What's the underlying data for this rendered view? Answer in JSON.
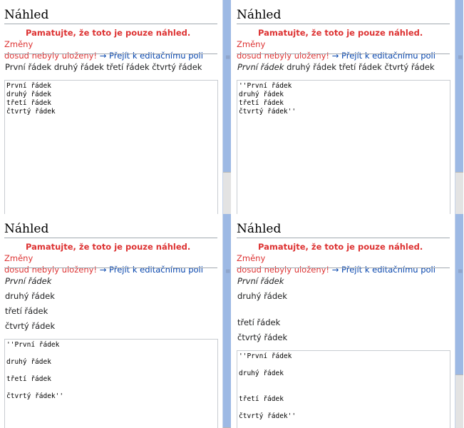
{
  "panels": [
    {
      "heading": "Náhled",
      "warning_bold": "Pamatujte, že toto je pouze náhled.",
      "warning_rest_1": " Změny",
      "warning_rest_2": "dosud nebyly uloženy!",
      "warning_link": "→ Přejít k editačnímu poli",
      "preview_lines": [
        {
          "italic": "",
          "normal": "První řádek druhý řádek třetí řádek čtvrtý řádek"
        }
      ],
      "textarea_lines": [
        "První řádek",
        "druhý řádek",
        "třetí řádek",
        "čtvrtý řádek"
      ]
    },
    {
      "heading": "Náhled",
      "warning_bold": "Pamatujte, že toto je pouze náhled.",
      "warning_rest_1": " Změny",
      "warning_rest_2": "dosud nebyly uloženy!",
      "warning_link": "→ Přejít k editačnímu poli",
      "preview_lines": [
        {
          "italic": "První řádek",
          "normal": " druhý řádek třetí řádek čtvrtý řádek"
        }
      ],
      "textarea_lines": [
        "''První řádek",
        "druhý řádek",
        "třetí řádek",
        "čtvrtý řádek''"
      ]
    },
    {
      "heading": "Náhled",
      "warning_bold": "Pamatujte, že toto je pouze náhled.",
      "warning_rest_1": " Změny",
      "warning_rest_2": "dosud nebyly uloženy!",
      "warning_link": "→ Přejít k editačnímu poli",
      "preview_lines": [
        {
          "italic": "První řádek",
          "normal": ""
        },
        {
          "italic": "",
          "normal": "druhý řádek"
        },
        {
          "italic": "",
          "normal": "třetí řádek"
        },
        {
          "italic": "",
          "normal": "čtvrtý řádek"
        }
      ],
      "textarea_lines": [
        "''První řádek",
        "",
        "druhý řádek",
        "",
        "třetí řádek",
        "",
        "čtvrtý řádek''"
      ]
    },
    {
      "heading": "Náhled",
      "warning_bold": "Pamatujte, že toto je pouze náhled.",
      "warning_rest_1": " Změny",
      "warning_rest_2": "dosud nebyly uloženy!",
      "warning_link": "→ Přejít k editačnímu poli",
      "preview_lines": [
        {
          "italic": "První řádek",
          "normal": ""
        },
        {
          "italic": "",
          "normal": "druhý řádek"
        },
        {
          "italic": "",
          "normal": "třetí řádek"
        },
        {
          "italic": "",
          "normal": "čtvrtý řádek"
        }
      ],
      "textarea_lines": [
        "''První řádek",
        "",
        "druhý řádek",
        "",
        "",
        "třetí řádek",
        "",
        "čtvrtý řádek''"
      ]
    }
  ],
  "icons": {
    "scrollbar_grip": "≡"
  },
  "colors": {
    "warning": "#dd3333",
    "link": "#0645ad",
    "scrollbar": "#9db9e4"
  }
}
